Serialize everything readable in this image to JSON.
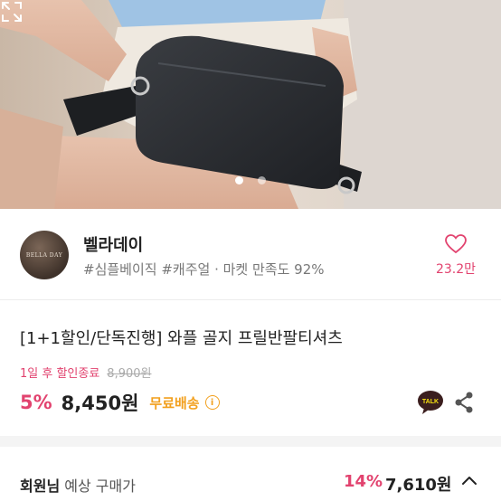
{
  "hero": {
    "slide_count": 2,
    "active_slide": 1,
    "icons": {
      "expand": "expand-icon"
    }
  },
  "shop": {
    "logo_text": "BELLA DAY",
    "name": "벨라데이",
    "tags": "#심플베이직 #캐주얼 · 마켓 만족도 92%",
    "like_count": "23.2만",
    "icons": {
      "like": "heart-outline-icon"
    }
  },
  "product": {
    "title": "[1+1할인/단독진행] 와플 골지 프릴반팔티셔츠",
    "sale_timer": "1일 후 할인종료",
    "original_price": "8,900원",
    "discount": "5%",
    "price": "8,450원",
    "shipping": "무료배송",
    "info_icon_text": "i",
    "talk_label": "TALK",
    "icons": {
      "talk": "kakaotalk-icon",
      "share": "share-icon",
      "info": "info-icon"
    }
  },
  "member": {
    "label": "회원님",
    "sub_label": " 예상 구매가",
    "discount": "14%",
    "price": "7,610원",
    "icons": {
      "toggle": "chevron-up-icon"
    }
  },
  "colors": {
    "accent_pink": "#e2436f",
    "shipping_orange": "#f2a01e",
    "text": "#222222",
    "muted": "#777777"
  }
}
